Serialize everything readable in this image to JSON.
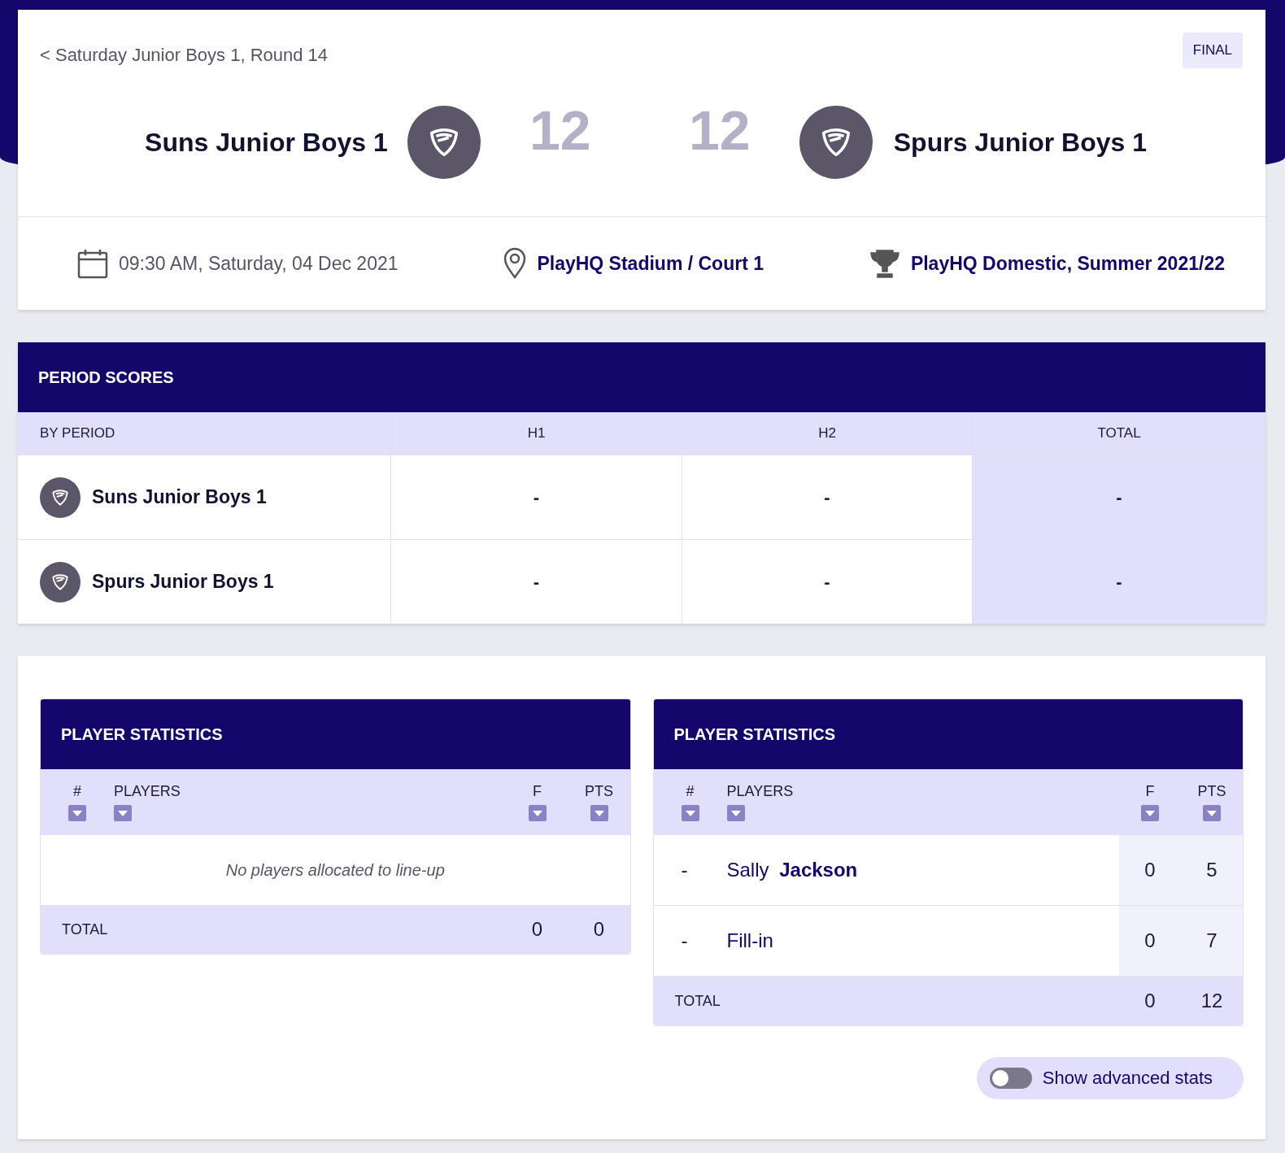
{
  "header": {
    "back_link": "< Saturday Junior Boys 1, Round 14",
    "status_badge": "FINAL",
    "home": {
      "name": "Suns Junior Boys 1",
      "score": "12"
    },
    "away": {
      "name": "Spurs Junior Boys 1",
      "score": "12"
    },
    "details": [
      {
        "kind": "date",
        "text": "09:30 AM, Saturday, 04 Dec 2021"
      },
      {
        "kind": "venue",
        "text": "PlayHQ Stadium / Court 1"
      },
      {
        "kind": "competition",
        "text": "PlayHQ Domestic, Summer 2021/22"
      }
    ]
  },
  "period_scores": {
    "title": "PERIOD SCORES",
    "columns": [
      "BY PERIOD",
      "H1",
      "H2",
      "TOTAL"
    ],
    "rows": [
      {
        "team": "Suns Junior Boys 1",
        "values": [
          "-",
          "-",
          "-"
        ]
      },
      {
        "team": "Spurs Junior Boys 1",
        "values": [
          "-",
          "-",
          "-"
        ]
      }
    ]
  },
  "player_stats": [
    {
      "title": "PLAYER STATISTICS",
      "columns": [
        "#",
        "PLAYERS",
        "F",
        "PTS"
      ],
      "empty_message": "No players allocated to line-up",
      "total": {
        "label": "TOTAL",
        "f": "0",
        "pts": "0"
      }
    },
    {
      "title": "PLAYER STATISTICS",
      "columns": [
        "#",
        "PLAYERS",
        "F",
        "PTS"
      ],
      "rows": [
        {
          "number": "-",
          "name": "Sally **Jackson**",
          "f": "0",
          "pts": "5"
        },
        {
          "number": "-",
          "name": "Fill-in",
          "f": "0",
          "pts": "7"
        }
      ],
      "total": {
        "label": "TOTAL",
        "f": "0",
        "pts": "12"
      }
    }
  ],
  "advanced_stats_toggle": {
    "label": "Show advanced stats",
    "on": false
  }
}
